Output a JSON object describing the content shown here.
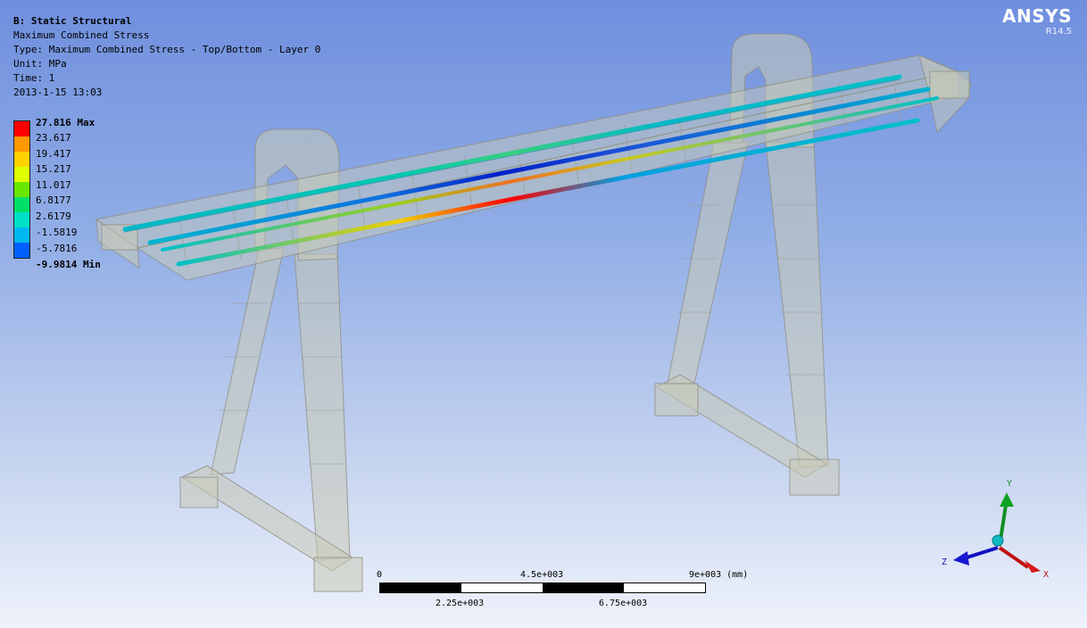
{
  "analysis": {
    "system": "B: Static Structural",
    "result_name": "Maximum Combined Stress",
    "type_line": "Type: Maximum Combined Stress - Top/Bottom - Layer 0",
    "unit_line": "Unit: MPa",
    "time_line": "Time: 1",
    "timestamp": "2013-1-15 13:03"
  },
  "legend": {
    "entries": [
      {
        "label": "27.816 Max",
        "color": "#ff0000"
      },
      {
        "label": "23.617",
        "color": "#ff9900"
      },
      {
        "label": "19.417",
        "color": "#ffd200"
      },
      {
        "label": "15.217",
        "color": "#dfff00"
      },
      {
        "label": "11.017",
        "color": "#68e800"
      },
      {
        "label": "6.8177",
        "color": "#00e068"
      },
      {
        "label": "2.6179",
        "color": "#00e0c8"
      },
      {
        "label": "-1.5819",
        "color": "#00b8f0"
      },
      {
        "label": "-5.7816",
        "color": "#0060ff"
      },
      {
        "label": "-9.9814 Min",
        "color": "#0000d8"
      }
    ]
  },
  "brand": {
    "name": "ANSYS",
    "version": "R14.5"
  },
  "scale_bar": {
    "top_ticks": [
      "0",
      "4.5e+003",
      "9e+003 (mm)"
    ],
    "bottom_ticks": [
      "2.25e+003",
      "6.75e+003"
    ]
  },
  "triad": {
    "x": "X",
    "y": "Y",
    "z": "Z"
  }
}
